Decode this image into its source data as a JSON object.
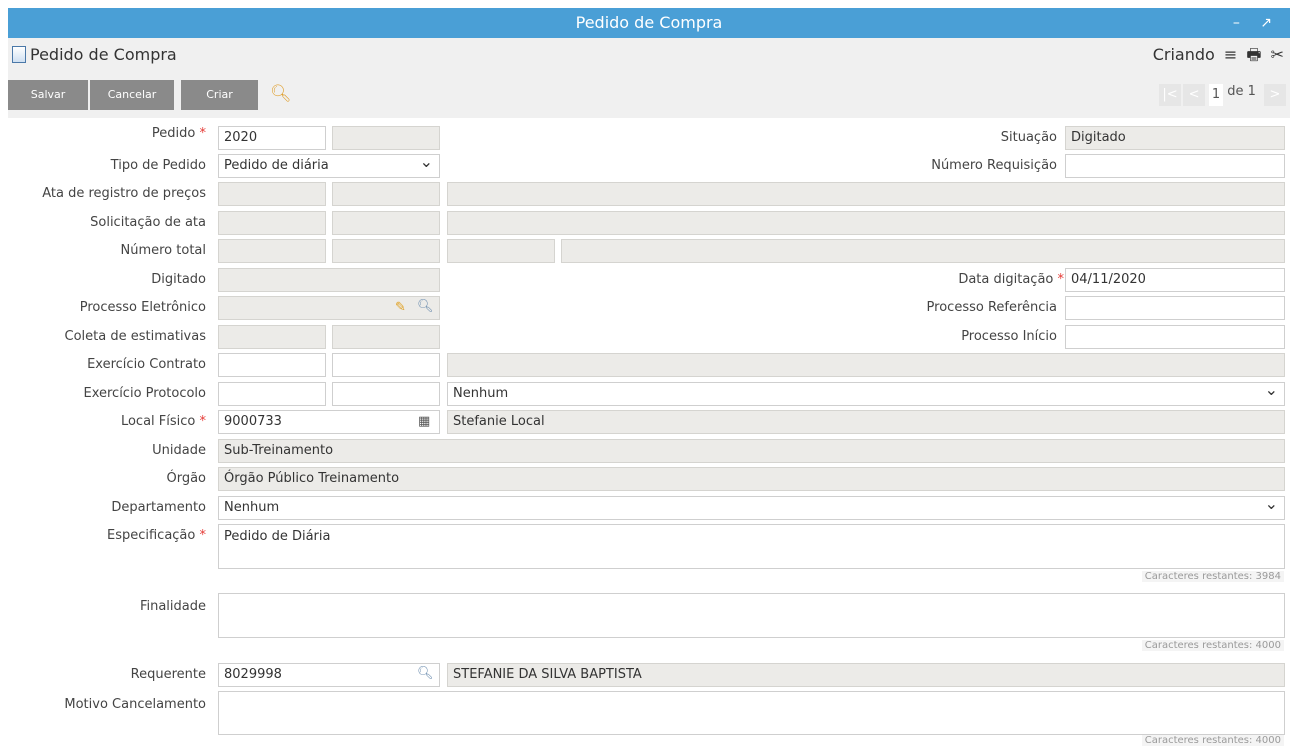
{
  "window": {
    "title": "Pedido de Compra",
    "controls": "– ↗"
  },
  "header": {
    "title": "Pedido de Compra",
    "mode": "Criando",
    "menu_icon": "≡",
    "print_icon": "🖶",
    "tools_icon": "✂"
  },
  "toolbar": {
    "salvar": "Salvar",
    "cancelar": "Cancelar",
    "criar": "Criar"
  },
  "pager": {
    "current": "1",
    "of_label": "de 1"
  },
  "form": {
    "pedido": {
      "label": "Pedido",
      "value": "2020"
    },
    "situacao": {
      "label": "Situação",
      "value": "Digitado"
    },
    "tipo_pedido": {
      "label": "Tipo de Pedido",
      "value": "Pedido de diária"
    },
    "numero_requisicao": {
      "label": "Número Requisição",
      "value": ""
    },
    "ata_registro": {
      "label": "Ata de registro de preços"
    },
    "solicitacao_ata": {
      "label": "Solicitação de ata"
    },
    "numero_total": {
      "label": "Número total"
    },
    "digitado": {
      "label": "Digitado"
    },
    "data_digitacao": {
      "label": "Data digitação",
      "value": "04/11/2020"
    },
    "processo_eletronico": {
      "label": "Processo Eletrônico"
    },
    "processo_referencia": {
      "label": "Processo Referência",
      "value": ""
    },
    "coleta_estimativas": {
      "label": "Coleta de estimativas"
    },
    "processo_inicio": {
      "label": "Processo Início",
      "value": ""
    },
    "exercicio_contrato": {
      "label": "Exercício Contrato"
    },
    "exercicio_protocolo": {
      "label": "Exercício Protocolo",
      "select": "Nenhum"
    },
    "local_fisico": {
      "label": "Local Físico",
      "code": "9000733",
      "name": "Stefanie Local"
    },
    "unidade": {
      "label": "Unidade",
      "value": "Sub-Treinamento"
    },
    "orgao": {
      "label": "Órgão",
      "value": "Órgão Público Treinamento"
    },
    "departamento": {
      "label": "Departamento",
      "value": "Nenhum"
    },
    "especificacao": {
      "label": "Especificação",
      "value": "Pedido de Diária",
      "counter": "Caracteres restantes: 3984"
    },
    "finalidade": {
      "label": "Finalidade",
      "value": "",
      "counter": "Caracteres restantes: 4000"
    },
    "requerente": {
      "label": "Requerente",
      "code": "8029998",
      "name": "STEFANIE DA SILVA BAPTISTA"
    },
    "motivo_cancelamento": {
      "label": "Motivo Cancelamento",
      "value": "",
      "counter": "Caracteres restantes: 4000"
    }
  }
}
